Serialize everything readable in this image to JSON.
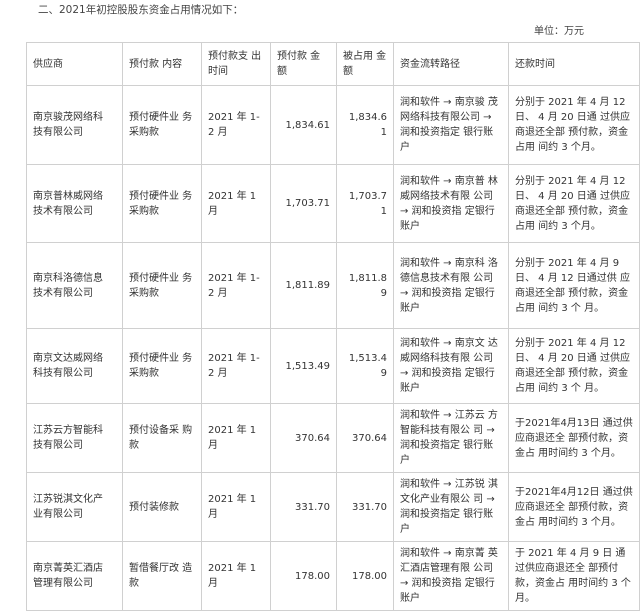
{
  "heading": "二、2021年初控股股东资金占用情况如下：",
  "unit": "单位：万元",
  "headers": [
    "供应商",
    "预付款 内容",
    "预付款支 出时间",
    "预付款 金额",
    "被占用 金额",
    "资金流转路径",
    "还款时间"
  ],
  "rows": [
    [
      "南京骏茂网络科 技有限公司",
      "预付硬件业 务采购款",
      "2021 年 1-2 月",
      "1,834.61",
      "1,834.61",
      "润和软件 → 南京骏 茂网络科技有限公司 → 润和投资指定 银行账户",
      "分别于 2021 年 4 月 12 日、 4 月 20 日通 过供应商退还全部 预付款，资金占用 间约 3 个月。"
    ],
    [
      "南京普林威网络 技术有限公司",
      "预付硬件业 务采购款",
      "2021 年 1 月",
      "1,703.71",
      "1,703.71",
      "润和软件 → 南京普 林威网络技术有限 公司 → 润和投资指 定银行账户",
      "分别于 2021 年 4 月 12 日、 4 月 20 日通 过供应商退还全部 预付款，资金占用 间约 3 个月。"
    ],
    [
      "南京科洛德信息 技术有限公司",
      "预付硬件业 务采购款",
      "2021 年 1-2 月",
      "1,811.89",
      "1,811.89",
      "润和软件 → 南京科 洛德信息技术有限 公司 → 润和投资指 定银行账户",
      "分别于 2021 年 4 月 9 日、 4 月 12 日通过供 应商退还全部 预付款，资金占用 间约 3 个 月。"
    ],
    [
      "南京文达威网络 科技有限公司",
      "预付硬件业 务采购款",
      "2021 年 1-2 月",
      "1,513.49",
      "1,513.49",
      "润和软件 → 南京文 达威网络科技有限 公司 → 润和投资指 定银行账户",
      "分别于 2021 年 4 月 12 日、 4 月 20 日通 过供应商退还全部 预付款，资金占用 间约 3 个 月。"
    ],
    [
      "江苏云方智能科 技有限公司",
      "预付设备采 购款",
      "2021 年 1 月",
      "370.64",
      "370.64",
      "润和软件 → 江苏云 方智能科技有限公 司 → 润和投资指定 银行账户",
      "于2021年4月13日 通过供应商退还全 部预付款，资金占 用时间约 3 个月。"
    ],
    [
      "江苏锐淇文化产 业有限公司",
      "预付装修款",
      "2021 年 1 月",
      "331.70",
      "331.70",
      "润和软件 → 江苏锐 淇文化产业有限公 司 → 润和投资指定 银行账户",
      "于2021年4月12日 通过供应商退还全 部预付款，资金占 用时间约 3 个月。"
    ],
    [
      "南京菁英汇酒店 管理有限公司",
      "暂借餐厅改 造款",
      "2021 年 1 月",
      "178.00",
      "178.00",
      "润和软件 → 南京菁 英汇酒店管理有限 公司 → 润和投资指 定银行账户",
      "于 2021 年 4 月 9 日 通过供应商退还全 部预付款，资金占 用时间约 3 个月。"
    ]
  ]
}
